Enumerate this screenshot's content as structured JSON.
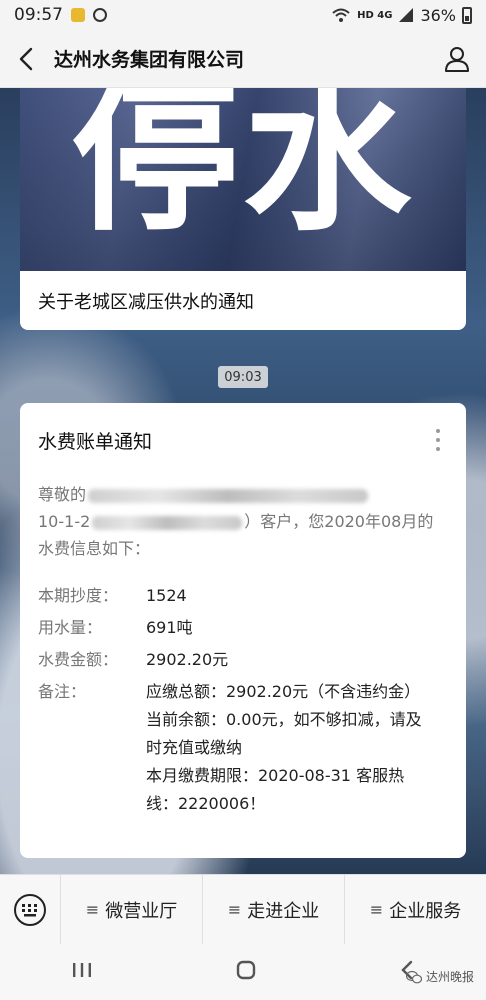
{
  "status_bar": {
    "time": "09:57",
    "network": "HD 4G",
    "battery": "36%"
  },
  "nav": {
    "title": "达州水务集团有限公司"
  },
  "article": {
    "cover_text": "停水",
    "title": "关于老城区减压供水的通知"
  },
  "time_label": "09:03",
  "bill": {
    "title": "水费账单通知",
    "greeting_prefix": "尊敬的",
    "greeting_line2_prefix": "10-1-2",
    "greeting_line2_suffix": "）客户，您2020年08月的",
    "greeting_line3": "水费信息如下：",
    "fields": [
      {
        "label": "本期抄度：",
        "value": "1524"
      },
      {
        "label": "用水量：",
        "value": "691吨"
      },
      {
        "label": "水费金额：",
        "value": "2902.20元"
      }
    ],
    "remark_label": "备注：",
    "remark_lines": [
      "应缴总额：2902.20元（不含违约金）",
      "当前余额：0.00元，如不够扣减，请及",
      "时充值或缴纳",
      "本月缴费期限：2020-08-31 客服热",
      "线：2220006！"
    ]
  },
  "menu": {
    "items": [
      {
        "label": "微营业厅"
      },
      {
        "label": "走进企业"
      },
      {
        "label": "企业服务"
      }
    ]
  },
  "watermark": "达州晚报"
}
